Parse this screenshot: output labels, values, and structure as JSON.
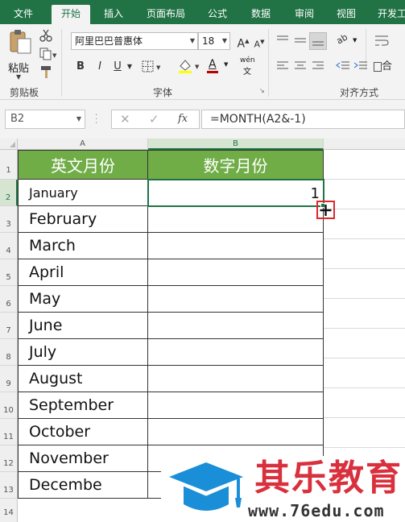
{
  "tabs": [
    "文件",
    "开始",
    "插入",
    "页面布局",
    "公式",
    "数据",
    "审阅",
    "视图",
    "开发工"
  ],
  "ribbon": {
    "paste_label": "粘贴",
    "clipboard_label": "剪贴板",
    "font_label": "字体",
    "align_label": "对齐方式",
    "font_name": "阿里巴巴普惠体",
    "font_size": "18",
    "bold": "B",
    "italic": "I",
    "underline": "U",
    "grow_font": "A",
    "shrink_font": "A",
    "font_color_glyph": "A",
    "phonetic": "wén",
    "wrap_glyph": "ab",
    "merge_glyph": "合"
  },
  "namebox": "B2",
  "fx": "fx",
  "formula": "=MONTH(A2&-1)",
  "columns": [
    "A",
    "B"
  ],
  "rows": [
    "1",
    "2",
    "3",
    "4",
    "5",
    "6",
    "7",
    "8",
    "9",
    "10",
    "11",
    "12",
    "13",
    "14"
  ],
  "table": {
    "headers": [
      "英文月份",
      "数字月份"
    ],
    "months": [
      "January",
      "February",
      "March",
      "April",
      "May",
      "June",
      "July",
      "August",
      "September",
      "October",
      "November",
      "Decembe"
    ],
    "b2_value": "1"
  },
  "watermark": {
    "title": "其乐教育",
    "url": "www.76edu.com"
  },
  "colors": {
    "excel_green": "#217346",
    "header_green": "#70ad47",
    "select_border": "#217346",
    "highlight_red": "#e0262a",
    "logo_blue": "#1a8fd8",
    "logo_red": "#d9303e"
  }
}
